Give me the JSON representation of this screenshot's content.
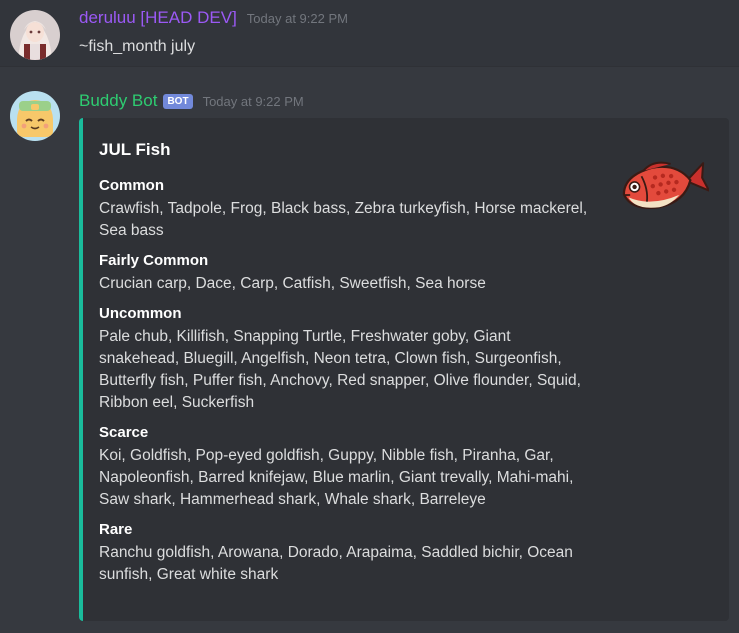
{
  "messages": [
    {
      "username": "deruluu [HEAD DEV]",
      "timestamp": "Today at 9:22 PM",
      "text": "~fish_month july",
      "avatar": "user-avatar-anime-girl",
      "name_color": "#9b59f5"
    },
    {
      "username": "Buddy Bot",
      "bot_tag": "BOT",
      "timestamp": "Today at 9:22 PM",
      "avatar": "bot-avatar-yellow-face",
      "name_color": "#2ecc71",
      "embed": {
        "title": "JUL Fish",
        "accent_color": "#1abc9c",
        "thumbnail": "red-snapper-fish-icon",
        "fields": [
          {
            "name": "Common",
            "value": "Crawfish, Tadpole, Frog, Black bass, Zebra turkeyfish, Horse mackerel, Sea bass"
          },
          {
            "name": "Fairly Common",
            "value": "Crucian carp, Dace, Carp, Catfish, Sweetfish, Sea horse"
          },
          {
            "name": "Uncommon",
            "value": "Pale chub, Killifish, Snapping Turtle, Freshwater goby, Giant snakehead, Bluegill, Angelfish, Neon tetra, Clown fish, Surgeonfish, Butterfly fish, Puffer fish, Anchovy, Red snapper, Olive flounder, Squid, Ribbon eel, Suckerfish"
          },
          {
            "name": "Scarce",
            "value": "Koi, Goldfish, Pop-eyed goldfish, Guppy, Nibble fish, Piranha, Gar, Napoleonfish, Barred knifejaw, Blue marlin, Giant trevally, Mahi-mahi, Saw shark, Hammerhead shark, Whale shark, Barreleye"
          },
          {
            "name": "Rare",
            "value": "Ranchu goldfish, Arowana, Dorado, Arapaima, Saddled bichir, Ocean sunfish, Great white shark"
          }
        ]
      }
    }
  ]
}
